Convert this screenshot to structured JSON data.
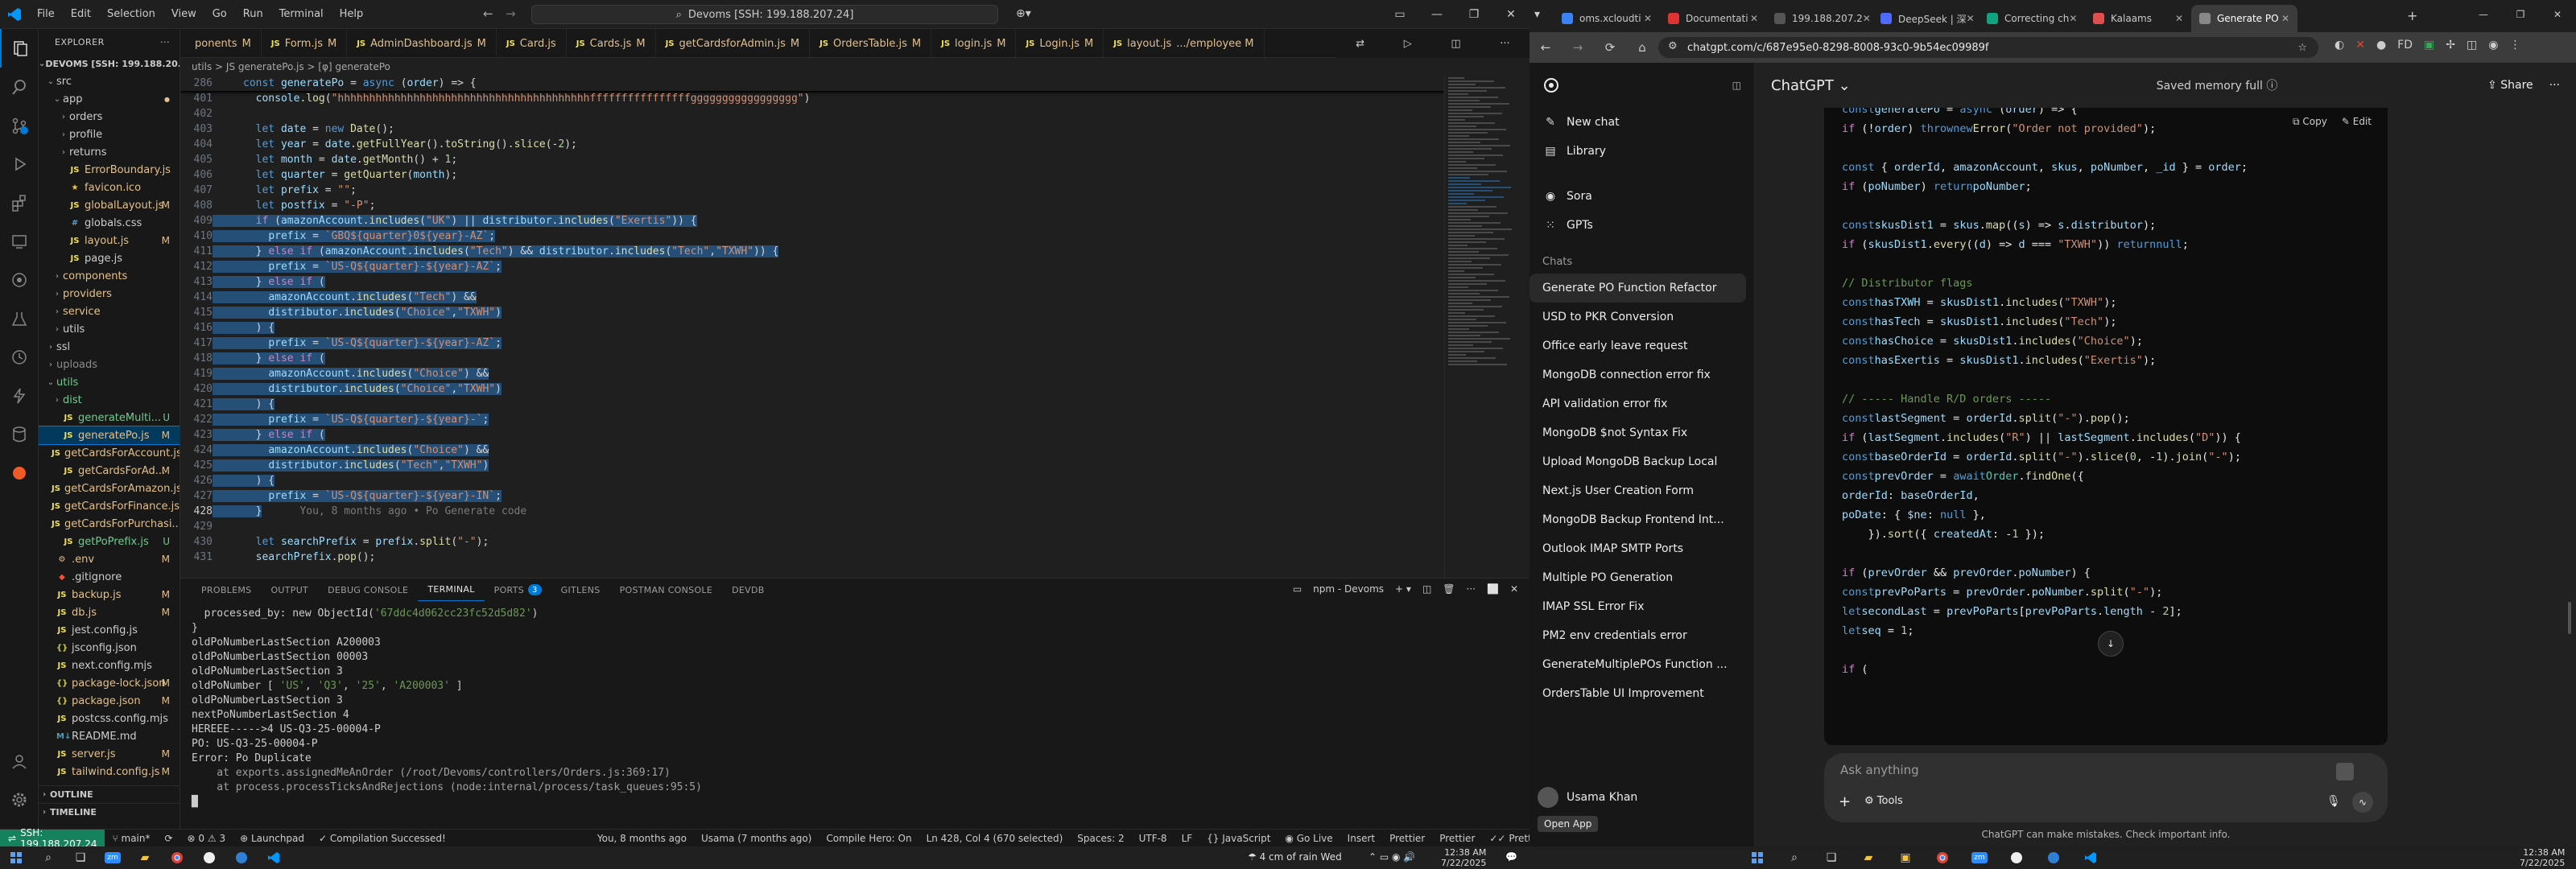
{
  "vscode": {
    "menu": [
      "File",
      "Edit",
      "Selection",
      "View",
      "Go",
      "Run",
      "Terminal",
      "Help"
    ],
    "command_center": "Devoms [SSH: 199.188.207.24]",
    "explorer_title": "EXPLORER",
    "workspace_root": "DEVOMS [SSH: 199.188.20...",
    "tree": [
      {
        "label": "src",
        "indent": 1,
        "type": "folder",
        "open": true
      },
      {
        "label": "app",
        "indent": 2,
        "type": "folder",
        "open": true,
        "status_color": "#e2c08d"
      },
      {
        "label": "orders",
        "indent": 3,
        "type": "folder",
        "open": false
      },
      {
        "label": "profile",
        "indent": 3,
        "type": "folder",
        "open": false
      },
      {
        "label": "returns",
        "indent": 3,
        "type": "folder",
        "open": false
      },
      {
        "label": "ErrorBoundary.js",
        "indent": 3,
        "type": "js",
        "color": "#e2c08d"
      },
      {
        "label": "favicon.ico",
        "indent": 3,
        "type": "ico",
        "color": "#e2c08d"
      },
      {
        "label": "globalLayout.js",
        "indent": 3,
        "type": "js",
        "status": "M",
        "color": "#e2c08d"
      },
      {
        "label": "globals.css",
        "indent": 3,
        "type": "css"
      },
      {
        "label": "layout.js",
        "indent": 3,
        "type": "js",
        "status": "M",
        "color": "#e2c08d"
      },
      {
        "label": "page.js",
        "indent": 3,
        "type": "js"
      },
      {
        "label": "components",
        "indent": 2,
        "type": "folder",
        "open": false,
        "color": "#e2c08d"
      },
      {
        "label": "providers",
        "indent": 2,
        "type": "folder",
        "open": false,
        "color": "#e2c08d"
      },
      {
        "label": "service",
        "indent": 2,
        "type": "folder",
        "open": false,
        "color": "#e2c08d"
      },
      {
        "label": "utils",
        "indent": 2,
        "type": "folder",
        "open": false
      },
      {
        "label": "ssl",
        "indent": 1,
        "type": "folder",
        "open": false
      },
      {
        "label": "uploads",
        "indent": 1,
        "type": "folder",
        "open": false,
        "color": "#8c8c8c"
      },
      {
        "label": "utils",
        "indent": 1,
        "type": "folder",
        "open": true,
        "color": "#73c991"
      },
      {
        "label": "dist",
        "indent": 2,
        "type": "folder",
        "open": false,
        "color": "#73c991"
      },
      {
        "label": "generateMulti...",
        "indent": 2,
        "type": "js",
        "status": "U",
        "color": "#73c991"
      },
      {
        "label": "generatePo.js",
        "indent": 2,
        "type": "js",
        "status": "M",
        "color": "#e2c08d",
        "selected": true
      },
      {
        "label": "getCardsForAccount.js",
        "indent": 2,
        "type": "js",
        "color": "#e2c08d"
      },
      {
        "label": "getCardsForAd...",
        "indent": 2,
        "type": "js",
        "status": "M",
        "color": "#e2c08d"
      },
      {
        "label": "getCardsForAmazon.js",
        "indent": 2,
        "type": "js",
        "color": "#e2c08d"
      },
      {
        "label": "getCardsForFinance.js",
        "indent": 2,
        "type": "js",
        "color": "#e2c08d"
      },
      {
        "label": "getCardsForPurchasi...",
        "indent": 2,
        "type": "js",
        "color": "#e2c08d"
      },
      {
        "label": "getPoPrefix.js",
        "indent": 2,
        "type": "js",
        "status": "U",
        "color": "#73c991"
      },
      {
        "label": ".env",
        "indent": 1,
        "type": "env",
        "status": "M",
        "color": "#e2c08d"
      },
      {
        "label": ".gitignore",
        "indent": 1,
        "type": "git"
      },
      {
        "label": "backup.js",
        "indent": 1,
        "type": "js",
        "status": "M",
        "color": "#e2c08d"
      },
      {
        "label": "db.js",
        "indent": 1,
        "type": "js",
        "status": "M",
        "color": "#e2c08d"
      },
      {
        "label": "jest.config.js",
        "indent": 1,
        "type": "js"
      },
      {
        "label": "jsconfig.json",
        "indent": 1,
        "type": "json"
      },
      {
        "label": "next.config.mjs",
        "indent": 1,
        "type": "js"
      },
      {
        "label": "package-lock.json",
        "indent": 1,
        "type": "json",
        "status": "M",
        "color": "#e2c08d"
      },
      {
        "label": "package.json",
        "indent": 1,
        "type": "json",
        "status": "M",
        "color": "#e2c08d"
      },
      {
        "label": "postcss.config.mjs",
        "indent": 1,
        "type": "js"
      },
      {
        "label": "README.md",
        "indent": 1,
        "type": "md"
      },
      {
        "label": "server.js",
        "indent": 1,
        "type": "js",
        "status": "M",
        "color": "#e2c08d"
      },
      {
        "label": "tailwind.config.js",
        "indent": 1,
        "type": "js",
        "status": "M",
        "color": "#e2c08d"
      }
    ],
    "outline_label": "OUTLINE",
    "timeline_label": "TIMELINE",
    "tabs": [
      {
        "label": "ponents",
        "status": "M"
      },
      {
        "label": "Form.js",
        "status": "M"
      },
      {
        "label": "AdminDashboard.js",
        "status": "M"
      },
      {
        "label": "Card.js",
        "status": ""
      },
      {
        "label": "Cards.js",
        "status": "M"
      },
      {
        "label": "getCardsforAdmin.js",
        "status": "M"
      },
      {
        "label": "OrdersTable.js",
        "status": "M"
      },
      {
        "label": "login.js",
        "status": "M"
      },
      {
        "label": "Login.js",
        "status": "M"
      },
      {
        "label": "layout.js",
        "status": ".../employee M"
      }
    ],
    "breadcrumb": "utils  >  JS generatePo.js  >  [φ] generatePo",
    "code_lines": [
      {
        "n": "286",
        "t": "const generatePo = async (order) => {",
        "sticky": true
      },
      {
        "n": "401",
        "t": "  console.log(\"hhhhhhhhhhhhhhhhhhhhhhhhhhhhhhhhhhhhhhhhffffffffffffffffggggggggggggggggg\")"
      },
      {
        "n": "402",
        "t": ""
      },
      {
        "n": "403",
        "t": "  let date = new Date();"
      },
      {
        "n": "404",
        "t": "  let year = date.getFullYear().toString().slice(-2);"
      },
      {
        "n": "405",
        "t": "  let month = date.getMonth() + 1;"
      },
      {
        "n": "406",
        "t": "  let quarter = getQuarter(month);"
      },
      {
        "n": "407",
        "t": "  let prefix = \"\";"
      },
      {
        "n": "408",
        "t": "  let postfix = \"-P\";"
      },
      {
        "n": "409",
        "t": "  if (amazonAccount.includes(\"UK\") || distributor.includes(\"Exertis\")) {",
        "hl": true
      },
      {
        "n": "410",
        "t": "    prefix = `GBQ${quarter}0${year}-AZ`;",
        "hl": true
      },
      {
        "n": "411",
        "t": "  } else if (amazonAccount.includes(\"Tech\") && distributor.includes(\"Tech\",\"TXWH\")) {",
        "hl": true
      },
      {
        "n": "412",
        "t": "    prefix = `US-Q${quarter}-${year}-AZ`;",
        "hl": true
      },
      {
        "n": "413",
        "t": "  } else if (",
        "hl": true
      },
      {
        "n": "414",
        "t": "    amazonAccount.includes(\"Tech\") &&",
        "hl": true
      },
      {
        "n": "415",
        "t": "    distributor.includes(\"Choice\",\"TXWH\")",
        "hl": true
      },
      {
        "n": "416",
        "t": "  ) {",
        "hl": true
      },
      {
        "n": "417",
        "t": "    prefix = `US-Q${quarter}-${year}-AZ`;",
        "hl": true
      },
      {
        "n": "418",
        "t": "  } else if (",
        "hl": true
      },
      {
        "n": "419",
        "t": "    amazonAccount.includes(\"Choice\") &&",
        "hl": true
      },
      {
        "n": "420",
        "t": "    distributor.includes(\"Choice\",\"TXWH\")",
        "hl": true
      },
      {
        "n": "421",
        "t": "  ) {",
        "hl": true
      },
      {
        "n": "422",
        "t": "    prefix = `US-Q${quarter}-${year}-`;",
        "hl": true
      },
      {
        "n": "423",
        "t": "  } else if (",
        "hl": true
      },
      {
        "n": "424",
        "t": "    amazonAccount.includes(\"Choice\") &&",
        "hl": true
      },
      {
        "n": "425",
        "t": "    distributor.includes(\"Tech\",\"TXWH\")",
        "hl": true
      },
      {
        "n": "426",
        "t": "  ) {",
        "hl": true
      },
      {
        "n": "427",
        "t": "    prefix = `US-Q${quarter}-${year}-IN`;",
        "hl": true
      },
      {
        "n": "428",
        "t": "  }",
        "hl": true,
        "ghost": "      You, 8 months ago • Po Generate code"
      },
      {
        "n": "429",
        "t": ""
      },
      {
        "n": "430",
        "t": "  let searchPrefix = prefix.split(\"-\");"
      },
      {
        "n": "431",
        "t": "  searchPrefix.pop();"
      }
    ],
    "panel_tabs": [
      "PROBLEMS",
      "OUTPUT",
      "DEBUG CONSOLE",
      "TERMINAL",
      "PORTS",
      "GITLENS",
      "POSTMAN CONSOLE",
      "DEVDB"
    ],
    "ports_badge": "3",
    "terminal_task": "npm - Devoms",
    "terminal_lines": [
      "  processed_by: new ObjectId('67ddc4d062cc23fc52d5d82')",
      "}",
      "oldPoNumberLastSection A200003",
      "oldPoNumberLastSection 00003",
      "oldPoNumberLastSection 3",
      "oldPoNumber [ 'US', 'Q3', '25', 'A200003' ]",
      "oldPoNumberLastSection 3",
      "nextPoNumberLastSection 4",
      "HEREEE----->4 US-Q3-25-00004-P",
      "PO: US-Q3-25-00004-P",
      "Error: Po Duplicate",
      "    at exports.assignedMeAnOrder (/root/Devoms/controllers/Orders.js:369:17)",
      "    at process.processTicksAndRejections (node:internal/process/task_queues:95:5)",
      "█"
    ],
    "status": {
      "ssh": "SSH: 199.188.207.24",
      "branch": "main*",
      "errors": "0",
      "warnings": "3",
      "launchpad": "Launchpad",
      "compilation": "Compilation Successed!",
      "blame": "You, 8 months ago",
      "author": "Usama (7 months ago)",
      "compile_hero": "Compile Hero: On",
      "position": "Ln 428, Col 4 (670 selected)",
      "spaces": "Spaces: 2",
      "encoding": "UTF-8",
      "eol": "LF",
      "language": "JavaScript",
      "golive": "Go Live",
      "insert": "Insert",
      "prettier": "Prettier",
      "prettier2": "Prettier",
      "prettier3": "Prettier"
    },
    "taskbar": {
      "weather": "4 cm of rain Wed",
      "time": "12:38 AM",
      "date": "7/22/2025"
    }
  },
  "chrome": {
    "tabs": [
      {
        "label": "oms.xcloudti",
        "color": "#3b82f6"
      },
      {
        "label": "Documentati",
        "color": "#d33"
      },
      {
        "label": "199.188.207.2",
        "color": "#555"
      },
      {
        "label": "DeepSeek | 深",
        "color": "#4d6bfe"
      },
      {
        "label": "Correcting ch",
        "color": "#10a37f"
      },
      {
        "label": "Kalaams",
        "color": "#e04e4e"
      },
      {
        "label": "Generate PO",
        "color": "#888",
        "active": true
      }
    ],
    "url": "chatgpt.com/c/687e95e0-8298-8008-93c0-9b54ec09989f",
    "sidebar": {
      "top": [
        {
          "label": "New chat",
          "icon": "✎"
        },
        {
          "label": "Library",
          "icon": "▤"
        },
        {
          "label": "Sora",
          "icon": "◉"
        },
        {
          "label": "GPTs",
          "icon": "⁙"
        }
      ],
      "chats_heading": "Chats",
      "chats": [
        "Generate PO Function Refactor",
        "USD to PKR Conversion",
        "Office early leave request",
        "MongoDB connection error fix",
        "API validation error fix",
        "MongoDB $not Syntax Fix",
        "Upload MongoDB Backup Local",
        "Next.js User Creation Form",
        "MongoDB Backup Frontend Int...",
        "Outlook IMAP SMTP Ports",
        "Multiple PO Generation",
        "IMAP SSL Error Fix",
        "PM2 env credentials error",
        "GenerateMultiplePOs Function ...",
        "OrdersTable UI Improvement"
      ],
      "user": "Usama Khan",
      "open_app": "Open App"
    },
    "header": {
      "model": "ChatGPT",
      "memory": "Saved memory full",
      "share": "Share"
    },
    "code_actions": {
      "copy": "Copy",
      "edit": "Edit"
    },
    "code_lines": [
      "const generatePo = async (order) => {",
      "  if (!order) throw new Error(\"Order not provided\");",
      "",
      "  const { orderId, amazonAccount, skus, poNumber, _id } = order;",
      "  if (poNumber) return poNumber;",
      "",
      "  const skusDist1 = skus.map((s) => s.distributor);",
      "  if (skusDist1.every((d) => d === \"TXWH\")) return null;",
      "",
      "  // Distributor flags",
      "  const hasTXWH = skusDist1.includes(\"TXWH\");",
      "  const hasTech = skusDist1.includes(\"Tech\");",
      "  const hasChoice = skusDist1.includes(\"Choice\");",
      "  const hasExertis = skusDist1.includes(\"Exertis\");",
      "",
      "  // ----- Handle R/D orders -----",
      "  const lastSegment = orderId.split(\"-\").pop();",
      "  if (lastSegment.includes(\"R\") || lastSegment.includes(\"D\")) {",
      "    const baseOrderId = orderId.split(\"-\").slice(0, -1).join(\"-\");",
      "    const prevOrder = await Order.findOne({",
      "      orderId: baseOrderId,",
      "      poDate: { $ne: null },",
      "    }).sort({ createdAt: -1 });",
      "",
      "    if (prevOrder && prevOrder.poNumber) {",
      "      const prevPoParts = prevOrder.poNumber.split(\"-\");",
      "      let secondLast = prevPoParts[prevPoParts.length - 2];",
      "      let seq = 1;",
      "",
      "      if ("
    ],
    "composer_placeholder": "Ask anything",
    "tools_label": "Tools",
    "disclaimer": "ChatGPT can make mistakes. Check important info.",
    "taskbar": {
      "time": "12:38 AM",
      "date": "7/22/2025"
    }
  }
}
